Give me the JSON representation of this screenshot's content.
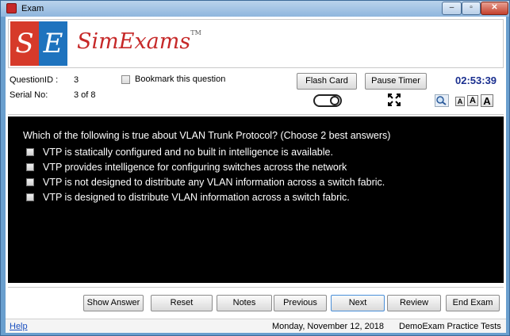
{
  "window": {
    "title": "Exam",
    "min_label": "–",
    "max_label": "▫",
    "close_label": "✕"
  },
  "banner": {
    "logo_left": "S",
    "logo_right": "E",
    "brand": "SimExams",
    "tm": "TM"
  },
  "info": {
    "question_id_label": "QuestionID :",
    "question_id_value": "3",
    "serial_label": "Serial No:",
    "serial_value": "3 of 8",
    "bookmark_label": "Bookmark this question",
    "flash_card": "Flash Card",
    "pause_timer": "Pause Timer",
    "timer": "02:53:39",
    "font_small": "A",
    "font_medium": "A",
    "font_large": "A"
  },
  "question": {
    "text": "Which of the following is true about VLAN Trunk Protocol? (Choose 2 best answers)",
    "options": [
      "VTP is statically configured and no built in intelligence is available.",
      "VTP provides intelligence for configuring switches across the network",
      "VTP is not designed to distribute any VLAN information across a switch fabric.",
      "VTP is designed to distribute VLAN information across a switch fabric."
    ]
  },
  "nav": {
    "show_answer": "Show Answer",
    "reset": "Reset",
    "notes": "Notes",
    "previous": "Previous",
    "next": "Next",
    "review": "Review",
    "end_exam": "End Exam"
  },
  "status": {
    "help": "Help",
    "date": "Monday, November 12, 2018",
    "product": "DemoExam Practice Tests"
  },
  "colors": {
    "timer": "#1a2f8f",
    "question_bg": "#000000",
    "brand_red": "#c62828",
    "brand_blue": "#1e73be"
  },
  "icons": [
    "exam-app-icon",
    "expand-icon",
    "zoom-icon",
    "toggle-switch-icon"
  ]
}
